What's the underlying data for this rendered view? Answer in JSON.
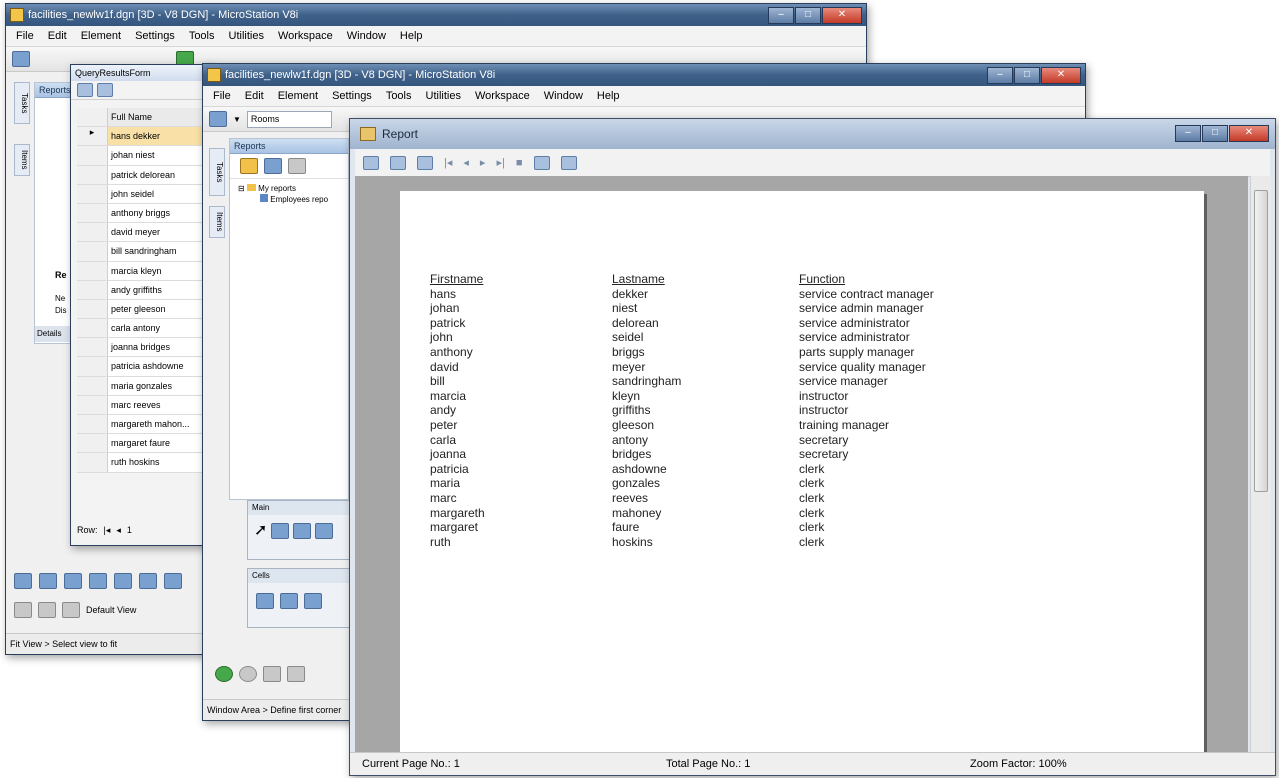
{
  "back_window": {
    "title": "facilities_newlw1f.dgn [3D - V8 DGN] - MicroStation V8i",
    "menu": [
      "File",
      "Edit",
      "Element",
      "Settings",
      "Tools",
      "Utilities",
      "Workspace",
      "Window",
      "Help"
    ],
    "side_tabs": [
      "Tasks",
      "Items"
    ],
    "panel_title": "Reports",
    "left_labels": [
      "Ne",
      "Dis"
    ],
    "details_label": "Details",
    "re_label": "Re",
    "status": "Fit View > Select view to fit",
    "default_view": "Default View"
  },
  "query_form": {
    "title": "QueryResultsForm",
    "column_header": "Full Name",
    "rows": [
      "hans dekker",
      "johan niest",
      "patrick delorean",
      "john seidel",
      "anthony briggs",
      "david meyer",
      "bill sandringham",
      "marcia kleyn",
      "andy griffiths",
      "peter gleeson",
      "carla antony",
      "joanna bridges",
      "patricia ashdowne",
      "maria gonzales",
      "marc reeves",
      "margareth mahon...",
      "margaret faure",
      "ruth hoskins"
    ],
    "nav_label": "Row:",
    "nav_value": "1"
  },
  "middle_window": {
    "title": "facilities_newlw1f.dgn [3D - V8 DGN] - MicroStation V8i",
    "menu": [
      "File",
      "Edit",
      "Element",
      "Settings",
      "Tools",
      "Utilities",
      "Workspace",
      "Window",
      "Help"
    ],
    "dropdown": "Rooms",
    "panel_title": "Reports",
    "side_tabs": [
      "Tasks",
      "Items"
    ],
    "tree": [
      "My reports",
      "Employees repo"
    ],
    "main_palette": "Main",
    "cells_palette": "Cells",
    "status": "Window Area > Define first corner"
  },
  "report": {
    "title": "Report",
    "columns": [
      {
        "header": "Firstname",
        "values": [
          "hans",
          "johan",
          "patrick",
          "john",
          "anthony",
          "david",
          "bill",
          "marcia",
          "andy",
          "peter",
          "carla",
          "joanna",
          "patricia",
          "maria",
          "marc",
          "margareth",
          "margaret",
          "ruth"
        ]
      },
      {
        "header": "Lastname",
        "values": [
          "dekker",
          "niest",
          "delorean",
          "seidel",
          "briggs",
          "meyer",
          "sandringham",
          "kleyn",
          "griffiths",
          "gleeson",
          "antony",
          "bridges",
          "ashdowne",
          "gonzales",
          "reeves",
          "mahoney",
          "faure",
          "hoskins"
        ]
      },
      {
        "header": "Function",
        "values": [
          "service contract manager",
          "service admin manager",
          "service administrator",
          "service administrator",
          "parts supply manager",
          "service quality manager",
          "service manager",
          "instructor",
          "instructor",
          "training manager",
          "secretary",
          "secretary",
          "clerk",
          "clerk",
          "clerk",
          "clerk",
          "clerk",
          "clerk"
        ]
      }
    ],
    "status": {
      "current_page": "Current Page No.: 1",
      "total_page": "Total Page No.: 1",
      "zoom": "Zoom Factor: 100%"
    }
  }
}
